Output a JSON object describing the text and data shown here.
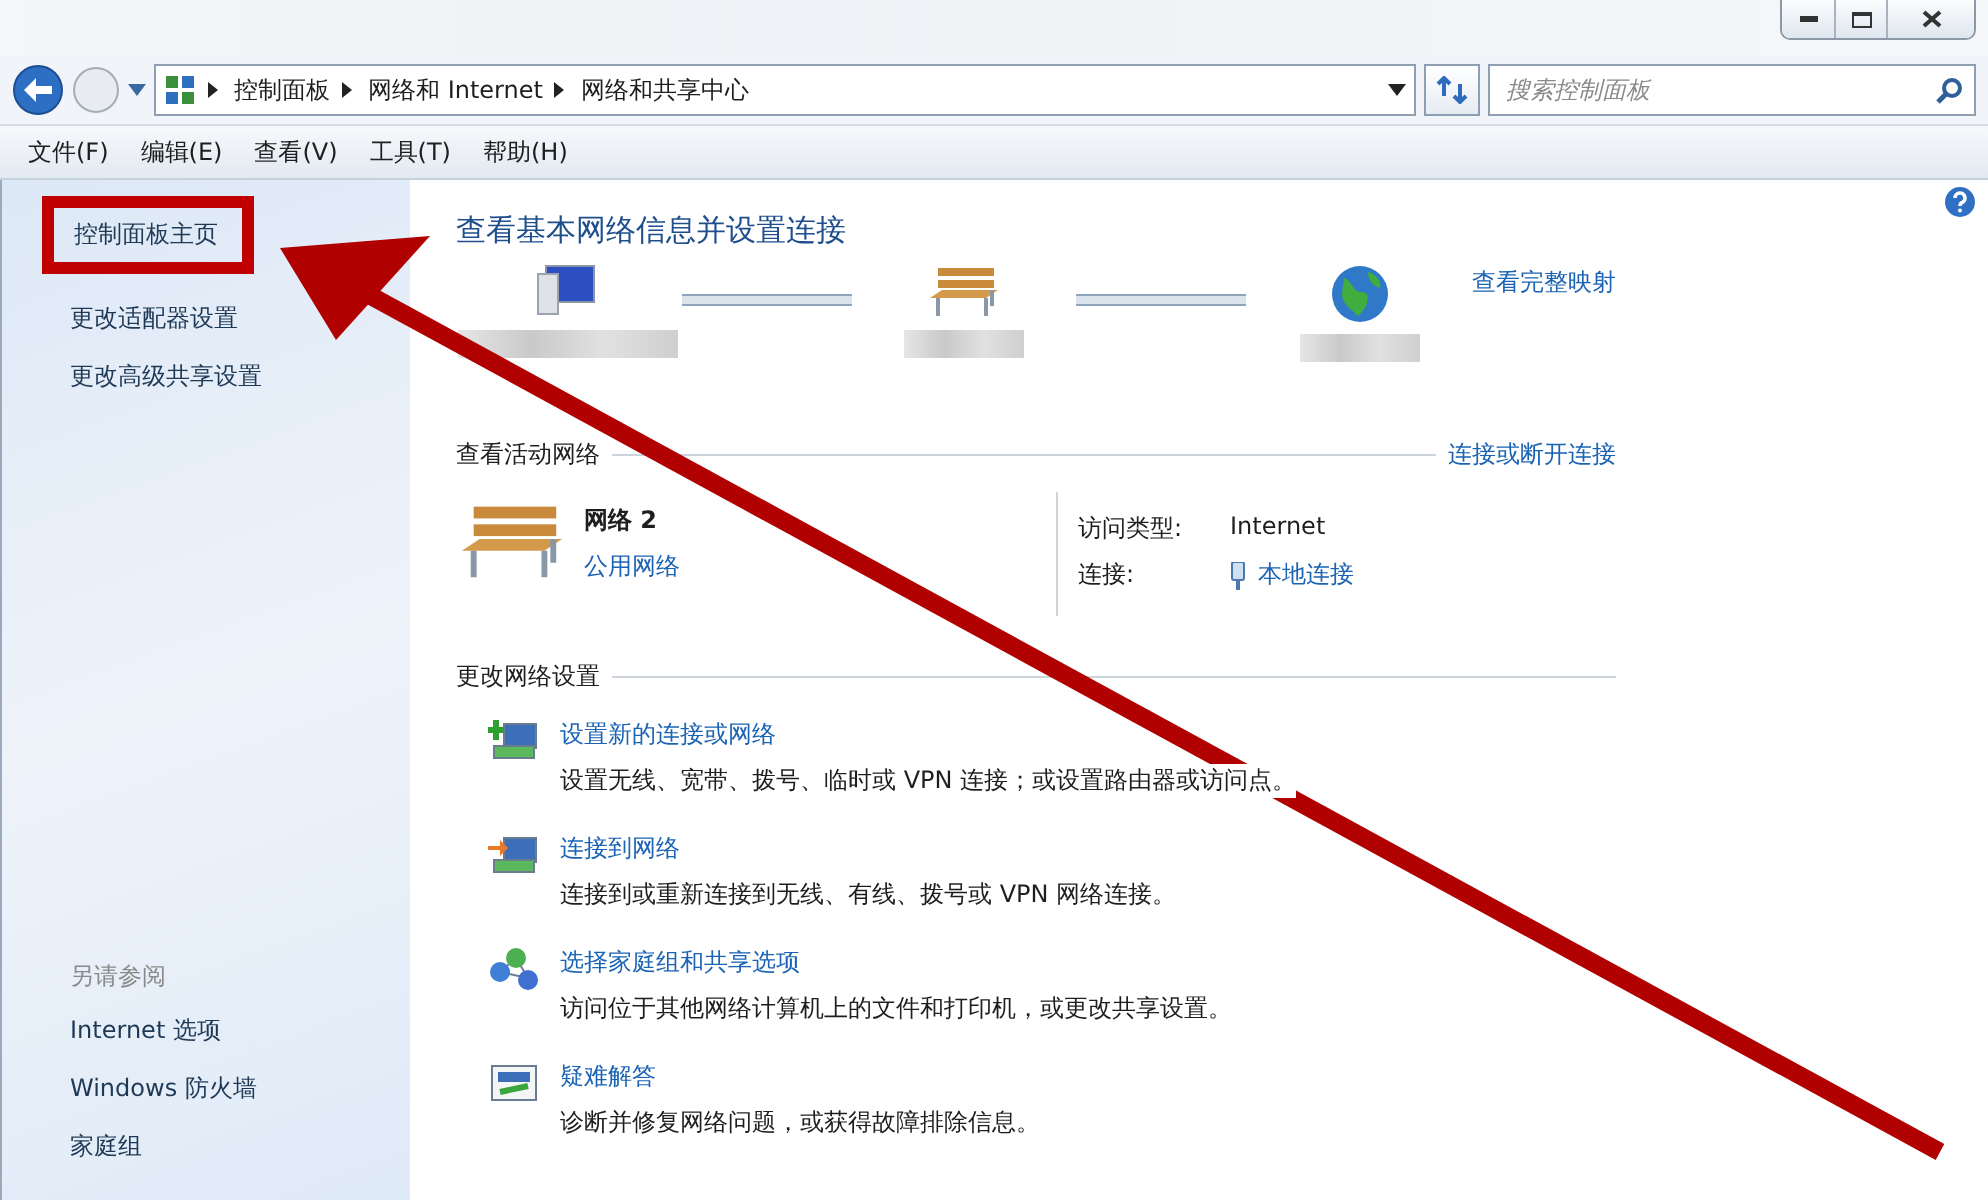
{
  "address_bar": {
    "breadcrumbs": [
      "控制面板",
      "网络和 Internet",
      "网络和共享中心"
    ]
  },
  "search": {
    "placeholder": "搜索控制面板"
  },
  "menu": [
    "文件(F)",
    "编辑(E)",
    "查看(V)",
    "工具(T)",
    "帮助(H)"
  ],
  "sidebar": {
    "links": [
      {
        "label": "控制面板主页",
        "highlighted": true
      },
      {
        "label": "更改适配器设置",
        "highlighted": false
      },
      {
        "label": "更改高级共享设置",
        "highlighted": false
      }
    ],
    "see_also_title": "另请参阅",
    "see_also": [
      "Internet 选项",
      "Windows 防火墙",
      "家庭组"
    ]
  },
  "main": {
    "title": "查看基本网络信息并设置连接",
    "map": {
      "link": "查看完整映射",
      "nodes": [
        {
          "kind": "computer"
        },
        {
          "kind": "network"
        },
        {
          "kind": "internet"
        }
      ]
    },
    "active_networks": {
      "heading": "查看活动网络",
      "link": "连接或断开连接",
      "network_name": "网络 2",
      "network_type": "公用网络",
      "access_type_label": "访问类型:",
      "access_type": "Internet",
      "connections_label": "连接:",
      "connection": "本地连接"
    },
    "change_settings": {
      "heading": "更改网络设置",
      "tasks": [
        {
          "kind": "new-connection",
          "title": "设置新的连接或网络",
          "description": "设置无线、宽带、拨号、临时或 VPN 连接；或设置路由器或访问点。"
        },
        {
          "kind": "connect",
          "title": "连接到网络",
          "description": "连接到或重新连接到无线、有线、拨号或 VPN 网络连接。"
        },
        {
          "kind": "homegroup",
          "title": "选择家庭组和共享选项",
          "description": "访问位于其他网络计算机上的文件和打印机，或更改共享设置。"
        },
        {
          "kind": "troubleshoot",
          "title": "疑难解答",
          "description": "诊断并修复网络问题，或获得故障排除信息。"
        }
      ]
    }
  }
}
